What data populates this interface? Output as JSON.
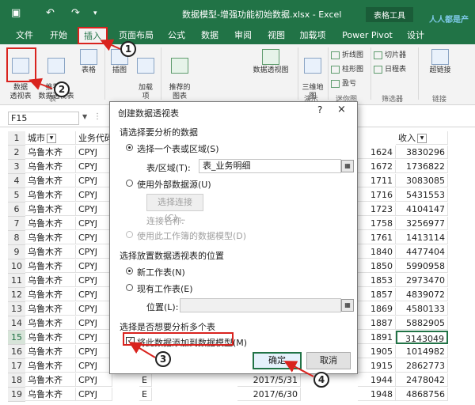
{
  "titlebar": {
    "doc_title": "数据模型-增强功能初始数据.xlsx - Excel",
    "context_title": "表格工具",
    "watermark": "人人都是产品经理",
    "colors": {
      "brand": "#217346",
      "annotation": "#d9231e"
    }
  },
  "tabs": [
    "文件",
    "开始",
    "插入",
    "页面布局",
    "公式",
    "数据",
    "审阅",
    "视图",
    "加载项",
    "Power Pivot",
    "设计"
  ],
  "active_tab": "插入",
  "ribbon": {
    "pivot_table": "数据\n透视表",
    "recommended_pivot": "推荐的\n数据透视表",
    "table": "表格",
    "illustrations": "插图",
    "addins": "加载\n项",
    "recommended_charts": "推荐的\n图表",
    "pivot_chart": "数据透视图",
    "map3d": "三维地\n图",
    "sparklines": [
      "折线图",
      "柱形图",
      "盈亏"
    ],
    "filters": [
      "切片器",
      "日程表"
    ],
    "link": "超链接",
    "groups": [
      "表",
      "演示",
      "迷你图",
      "筛选器",
      "链接"
    ]
  },
  "formula_bar": {
    "name_box": "F15"
  },
  "grid": {
    "headers": [
      "城市",
      "业务代码",
      "收入"
    ],
    "rows": [
      {
        "n": "2",
        "city": "乌鲁木齐",
        "code": "CPYJ",
        "v": "1624",
        "income": "3830296"
      },
      {
        "n": "3",
        "city": "乌鲁木齐",
        "code": "CPYJ",
        "v": "1672",
        "income": "1736822"
      },
      {
        "n": "4",
        "city": "乌鲁木齐",
        "code": "CPYJ",
        "v": "1711",
        "income": "3083085"
      },
      {
        "n": "5",
        "city": "乌鲁木齐",
        "code": "CPYJ",
        "v": "1716",
        "income": "5431553"
      },
      {
        "n": "6",
        "city": "乌鲁木齐",
        "code": "CPYJ",
        "v": "1723",
        "income": "4104147"
      },
      {
        "n": "7",
        "city": "乌鲁木齐",
        "code": "CPYJ",
        "v": "1758",
        "income": "3256977"
      },
      {
        "n": "8",
        "city": "乌鲁木齐",
        "code": "CPYJ",
        "v": "1761",
        "income": "1413114"
      },
      {
        "n": "9",
        "city": "乌鲁木齐",
        "code": "CPYJ",
        "v": "1840",
        "income": "4477404"
      },
      {
        "n": "10",
        "city": "乌鲁木齐",
        "code": "CPYJ",
        "v": "1850",
        "income": "5990958"
      },
      {
        "n": "11",
        "city": "乌鲁木齐",
        "code": "CPYJ",
        "v": "1853",
        "income": "2973470"
      },
      {
        "n": "12",
        "city": "乌鲁木齐",
        "code": "CPYJ",
        "v": "1857",
        "income": "4839072"
      },
      {
        "n": "13",
        "city": "乌鲁木齐",
        "code": "CPYJ",
        "v": "1869",
        "income": "4580133"
      },
      {
        "n": "14",
        "city": "乌鲁木齐",
        "code": "CPYJ",
        "v": "1887",
        "income": "5882905"
      },
      {
        "n": "15",
        "city": "乌鲁木齐",
        "code": "CPYJ",
        "v": "1891",
        "income": "3143049"
      },
      {
        "n": "16",
        "city": "乌鲁木齐",
        "code": "CPYJ",
        "v": "1905",
        "income": "1014982"
      },
      {
        "n": "17",
        "city": "乌鲁木齐",
        "code": "CPYJ",
        "v": "1915",
        "income": "2862773"
      },
      {
        "n": "18",
        "city": "乌鲁木齐",
        "code": "CPYJ",
        "v": "1944",
        "income": "2478042"
      },
      {
        "n": "19",
        "city": "乌鲁木齐",
        "code": "CPYJ",
        "v": "1948",
        "income": "4868756"
      }
    ],
    "row18_partial": "E",
    "row19_partial": "E",
    "row18_date": "2017/5/31",
    "row19_date": "2017/6/30"
  },
  "dialog": {
    "title": "创建数据透视表",
    "help": "?",
    "close": "×",
    "section1": "请选择要分析的数据",
    "opt_select_table": "选择一个表或区域(S)",
    "table_range_label": "表/区域(T):",
    "table_range_value": "表_业务明细",
    "opt_external": "使用外部数据源(U)",
    "choose_connection": "选择连接(C)...",
    "connection_name": "连接名称:",
    "opt_data_model": "使用此工作簿的数据模型(D)",
    "section2": "选择放置数据透视表的位置",
    "opt_new_sheet": "新工作表(N)",
    "opt_existing_sheet": "现有工作表(E)",
    "location_label": "位置(L):",
    "section3": "选择是否想要分析多个表",
    "add_to_model": "将此数据添加到数据模型(M)",
    "ok": "确定",
    "cancel": "取消"
  },
  "callouts": [
    "1",
    "2",
    "3",
    "4"
  ]
}
